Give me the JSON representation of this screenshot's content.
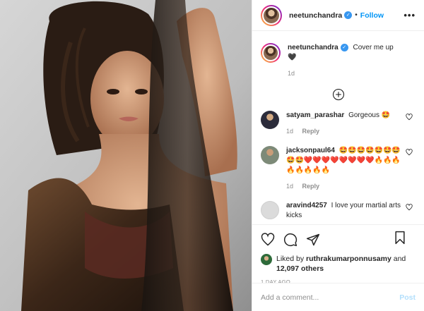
{
  "header": {
    "username": "neetunchandra",
    "verified_glyph": "✓",
    "separator": "•",
    "follow_label": "Follow",
    "more_glyph": "•••"
  },
  "caption": {
    "username": "neetunchandra",
    "text": "Cover me up",
    "emoji": "🖤",
    "time": "1d"
  },
  "load_more_icon": "plus-circle-icon",
  "comments": [
    {
      "username": "satyam_parashar",
      "text": "Gorgeous 🤩",
      "time": "1d",
      "reply_label": "Reply",
      "avatar_color": "#2b2b3a"
    },
    {
      "username": "jacksonpaul64",
      "text": "🤩🤩🤩🤩🤩🤩🤩🤩🤩❤️❤️❤️❤️❤️❤️❤️❤️🔥🔥🔥🔥🔥🔥🔥🔥",
      "time": "1d",
      "reply_label": "Reply",
      "avatar_color": "#7d8a78"
    },
    {
      "username": "aravind4257",
      "text": "I love your martial arts kicks",
      "avatar_color": "#dbdbdb"
    }
  ],
  "likes": {
    "prefix": "Liked by",
    "user": "ruthrakumarponnusamy",
    "and": "and",
    "others": "12,097 others"
  },
  "timestamp": "1 DAY AGO",
  "add_comment": {
    "placeholder": "Add a comment...",
    "post_label": "Post"
  },
  "colors": {
    "accent": "#0095f6",
    "post_disabled": "#b2dffc",
    "muted": "#8e8e8e",
    "text": "#262626"
  }
}
